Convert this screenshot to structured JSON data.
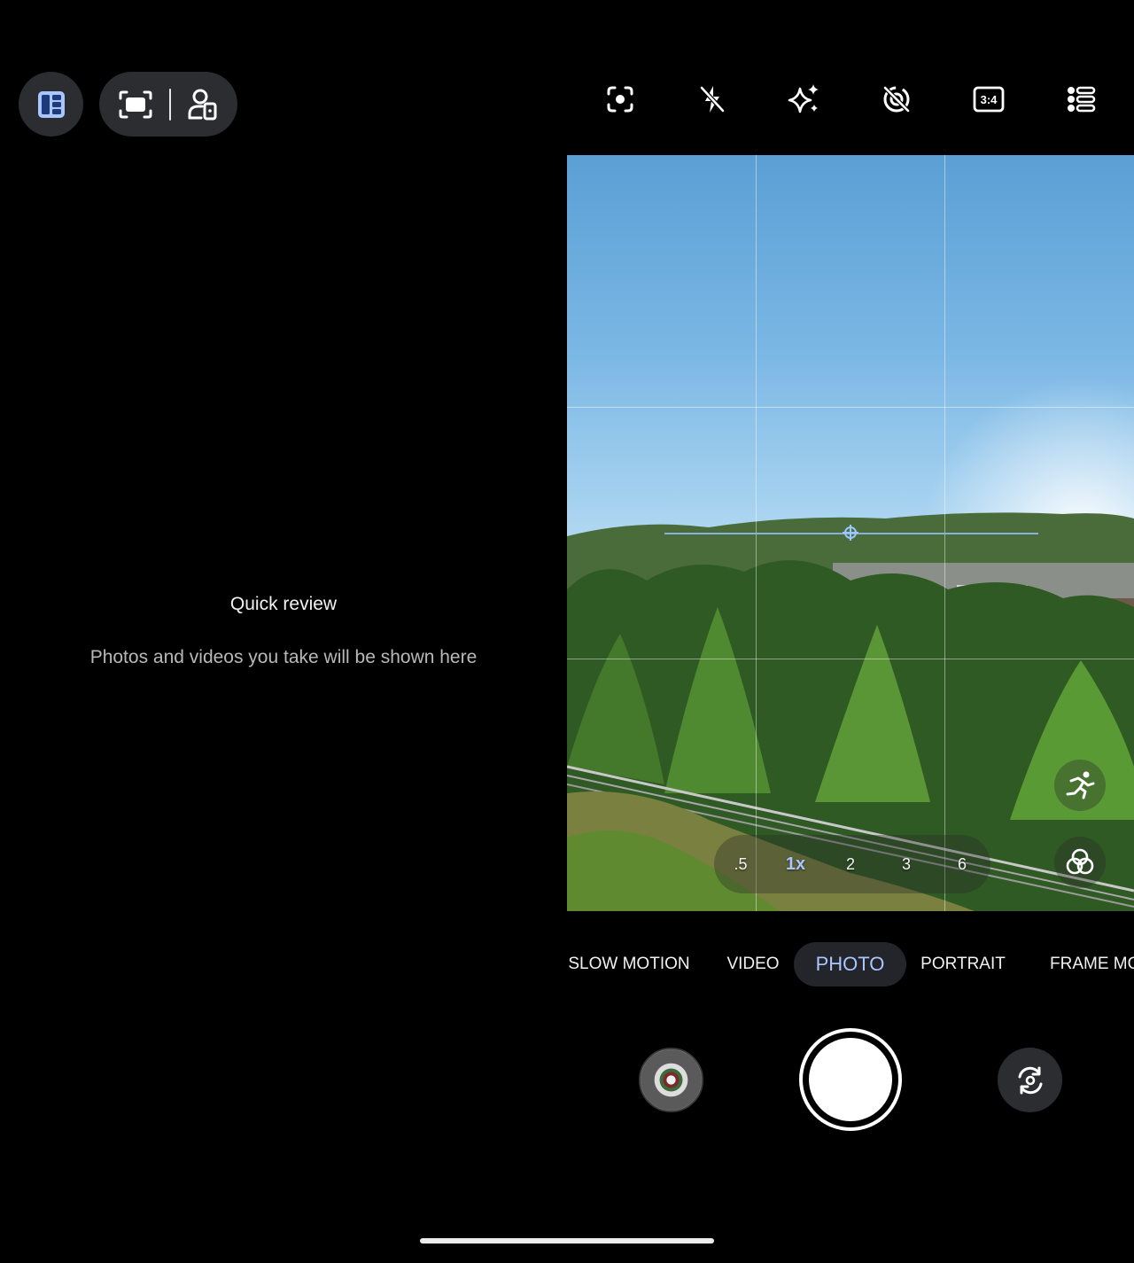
{
  "top_left": {
    "layout_icon": "dual-screen-layout-icon",
    "capture_icon": "frame-capture-icon",
    "person_icon": "cover-screen-preview-icon"
  },
  "toolbar": {
    "icons": [
      "lens-icon",
      "flash-off-icon",
      "sparkle-effects-icon",
      "motion-photo-off-icon",
      "aspect-ratio-icon",
      "settings-list-icon"
    ],
    "aspect_ratio_label": "3:4"
  },
  "quick_review": {
    "title": "Quick review",
    "subtitle": "Photos and videos you take will be shown here"
  },
  "zoom": {
    "levels": [
      ".5",
      "1x",
      "2",
      "3",
      "6"
    ],
    "active": "1x"
  },
  "viewfinder_controls": {
    "motion_icon": "running-person-icon",
    "filters_icon": "filters-icon"
  },
  "modes": {
    "items": [
      "SLOW MOTION",
      "VIDEO",
      "PHOTO",
      "PORTRAIT",
      "FRAME MODE"
    ],
    "active": "PHOTO"
  },
  "bottom": {
    "gallery_icon": "gallery-thumbnail",
    "shutter_icon": "shutter-button",
    "flip_icon": "flip-camera-icon"
  },
  "colors": {
    "accent": "#a9c6ff",
    "pill_bg": "#2b2d31",
    "background": "#000000"
  }
}
